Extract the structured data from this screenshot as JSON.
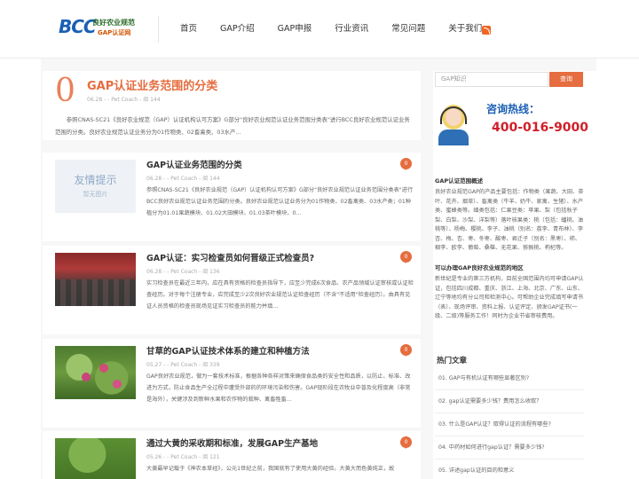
{
  "header": {
    "logo": {
      "mark": "BCC",
      "line1": "良好农业规范",
      "line2": "GAP认证网"
    },
    "nav": [
      "首页",
      "GAP介绍",
      "GAP申报",
      "行业资讯",
      "常见问题",
      "关于我们"
    ]
  },
  "feature": {
    "number": "0",
    "title": "GAP认证业务范围的分类",
    "meta": "06.28 - - Pet Coach - 阅 144",
    "excerpt": "参照CNAS-SC21《良好农业规范（GAP）认证机构认可方案》G部分\"良好农业规范认证业务范围分类表\"进行BCC良好农业规范认证业务范围的分类。良好农业规范认证业务分为01作物类、02畜禽类、03水产..."
  },
  "posts": [
    {
      "title": "GAP认证业务范围的分类",
      "meta": "06.28 - - Pet Coach - 阅 144",
      "excerpt": "参照CNAS-SC21《良好农业规范（GAP）认证机构认可方案》G部分\"良好农业规范认证业务范围分类表\"进行BCC良好农业规范认证业务范围的分类。良好农业规范认证业务分为01作物类、02畜禽类、03水产类；01种植分为01.01果蔬模块、01.02大田模块、01.03茶叶模块、0...",
      "comments": "0",
      "thumb_line1": "友情提示",
      "thumb_line2": "暂无图片"
    },
    {
      "title": "GAP认证：实习检查员如何晋级正式检查员?",
      "meta": "06.28 - - Pet Coach - 阅 136",
      "excerpt": "实习检查员在最近三年内，应在具有资格的检查员指导下，应至少完成6次食品、农产品领域认证审核或认证检查经历。对于每个注册专业，应完成至少2次良好农业规范认证检查经历（不含\"不适用\"检查经历）。由具有见证人员资格的检查员现场见证实习检查员的能力并填...",
      "comments": "0"
    },
    {
      "title": "甘草的GAP认证技术体系的建立和种植方法",
      "meta": "05.27 - - Pet Coach - 阅 339",
      "excerpt": "GAP良好农业规范，做为一套技术标准，根据各种各样对策来确保食品类的安全性和品质，以防止、标准、改进为方式，防止食品生产全过程中遭受外部的的环境污染和伤害。GAP现阶段在农牧业中普及化程度高（非常是海外），关键涉及到新鲜水果和农作物的栽种、禽畜牲畜...",
      "comments": "0"
    },
    {
      "title": "通过大黄的采收期和标准，发展GAP生产基地",
      "meta": "05.26 - - Pet Coach - 阅 121",
      "excerpt": "大黄最早记载于《神农本草经》，公元1世纪之前，我国就有了使用大黄的经验。大黄大而色黄纯正，故",
      "comments": "0"
    }
  ],
  "sidebar": {
    "search_placeholder": "GAP知识",
    "search_button": "查询",
    "hotline_title": "咨询热线：",
    "hotline_number": "400-016-9000",
    "overview_head": "GAP认证范围概述",
    "overview_text": "良好农业规范GAP的产品主要包括：作物类（果蔬、大田、茶叶、花卉、烟草）、畜禽类（牛羊、奶牛、家禽、生猪）、水产类、蜜蜂类等。细类包括：仁果豆类：苹果、梨（包括秋子梨、白梨、沙梨、洋梨等）落叶核果类：桃（包括：蟠桃、油桃等）、杨梅、樱桃、李子、油桃（别名：荔李、青布林）、李杏、梅、杏、枣、冬枣、酸枣、君迁子（别名：黑枣）、柿、稠李、欧李、葡萄、桑椹、无花果、猕猴桃、枸杞等。",
    "region_head": "可以办理GAP良好农业规范的地区",
    "region_text": "新世纪是专业的第三方机构，目前全国范围内均可申请GAP认证，包括四川成都、重庆、浙江、上海、北京、广东、山东、辽宁等地均有分公司和检测中心。可帮助企业完成填写申请书（表）、现场评审、资料上报、认证评定、颁发GAP证书(一级、二级)等服务工作！同时为企业节省审核费用。",
    "hot_head": "热门文章",
    "hot_articles": [
      "01. GAP与有机认证有哪些显著区别?",
      "02. gap认证需要多少钱？费用怎么收取？",
      "03. 什么是GAP认证？取得认证的流程有哪些?",
      "04. 中药材如何进行gap认证？需要多少钱?",
      "05. 详述gap认证的目的和意义"
    ]
  }
}
